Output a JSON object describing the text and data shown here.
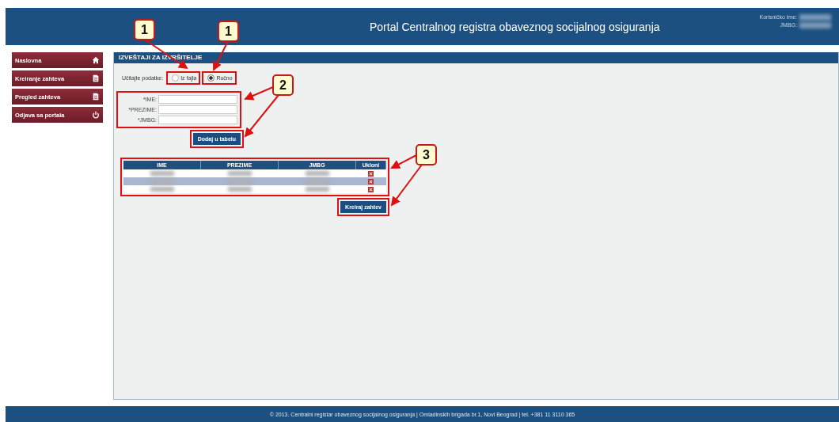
{
  "header": {
    "title": "Portal Centralnog registra obaveznog socijalnog osiguranja",
    "user_labels": [
      "Korisničko ime:",
      "JMBG:"
    ]
  },
  "sidebar": {
    "items": [
      {
        "label": "Naslovna",
        "kind": "home"
      },
      {
        "label": "Kreiranje zahteva",
        "kind": "document"
      },
      {
        "label": "Pregled zahteva",
        "kind": "document"
      },
      {
        "label": "Odjava sa portala",
        "kind": "power"
      }
    ]
  },
  "panel": {
    "title": "IZVEŠTAJI ZA IZVRŠITELJE",
    "source_label": "Učitajte podatke:",
    "source_options": [
      {
        "label": "Iz fajla",
        "selected": false
      },
      {
        "label": "Ručno",
        "selected": true
      }
    ],
    "fields": [
      {
        "label": "*IME:"
      },
      {
        "label": "*PREZIME:"
      },
      {
        "label": "*JMBG:"
      }
    ],
    "add_button": "Dodaj u tabelu",
    "table": {
      "columns": [
        "IME",
        "PREZIME",
        "JMBG",
        "Ukloni"
      ],
      "rows": [
        {
          "selected": false
        },
        {
          "selected": true
        },
        {
          "selected": false
        }
      ]
    },
    "create_button": "Kreiraj zahtev"
  },
  "footer": "© 2013. Centralni registar obaveznog socijalnog osiguranja | Omladinskih brigada br.1, Novi Beograd | tel. +381 11 3110 365",
  "annotations": [
    {
      "label": "1"
    },
    {
      "label": "1"
    },
    {
      "label": "2"
    },
    {
      "label": "3"
    }
  ]
}
